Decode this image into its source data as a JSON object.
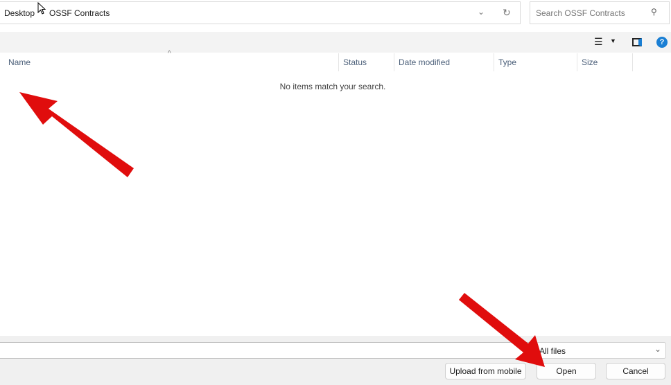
{
  "address": {
    "breadcrumb": [
      "Desktop",
      "OSSF Contracts"
    ]
  },
  "search": {
    "placeholder": "Search OSSF Contracts"
  },
  "columns": [
    "Name",
    "Status",
    "Date modified",
    "Type",
    "Size"
  ],
  "empty_message": "No items match your search.",
  "filename": {
    "value": ""
  },
  "filetype": {
    "selected": "All files"
  },
  "buttons": {
    "upload": "Upload from mobile",
    "open": "Open",
    "cancel": "Cancel"
  },
  "colors": {
    "arrow": "#e00d0d",
    "help": "#1a7fd4"
  }
}
